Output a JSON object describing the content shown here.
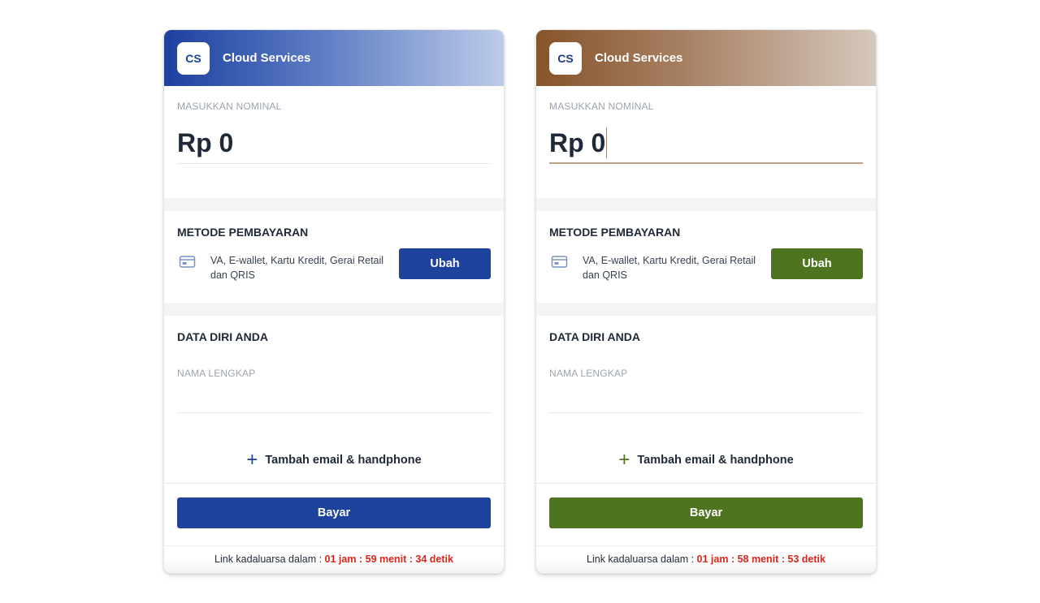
{
  "cards": [
    {
      "theme": "blue",
      "header": {
        "logo_text": "CS",
        "brand": "Cloud Services"
      },
      "nominal": {
        "label": "MASUKKAN NOMINAL",
        "value": "Rp 0"
      },
      "method": {
        "title": "METODE PEMBAYARAN",
        "icon": "credit-card-icon",
        "description": "VA, E-wallet, Kartu Kredit, Gerai Retail dan QRIS",
        "button_label": "Ubah"
      },
      "personal": {
        "title": "DATA DIRI ANDA",
        "name_label": "NAMA LENGKAP",
        "add_contact_label": "Tambah email & handphone"
      },
      "pay_label": "Bayar",
      "expiry": {
        "prefix": "Link kadaluarsa dalam :",
        "timer": "01 jam : 59 menit : 34 detik"
      },
      "colors": {
        "accent": "#1e439c"
      }
    },
    {
      "theme": "brown",
      "header": {
        "logo_text": "CS",
        "brand": "Cloud Services"
      },
      "nominal": {
        "label": "MASUKKAN NOMINAL",
        "value": "Rp 0"
      },
      "method": {
        "title": "METODE PEMBAYARAN",
        "icon": "credit-card-icon",
        "description": "VA, E-wallet, Kartu Kredit, Gerai Retail dan QRIS",
        "button_label": "Ubah"
      },
      "personal": {
        "title": "DATA DIRI ANDA",
        "name_label": "NAMA LENGKAP",
        "add_contact_label": "Tambah email & handphone"
      },
      "pay_label": "Bayar",
      "expiry": {
        "prefix": "Link kadaluarsa dalam :",
        "timer": "01 jam : 58 menit : 53 detik"
      },
      "colors": {
        "accent": "#4e7420"
      }
    }
  ]
}
